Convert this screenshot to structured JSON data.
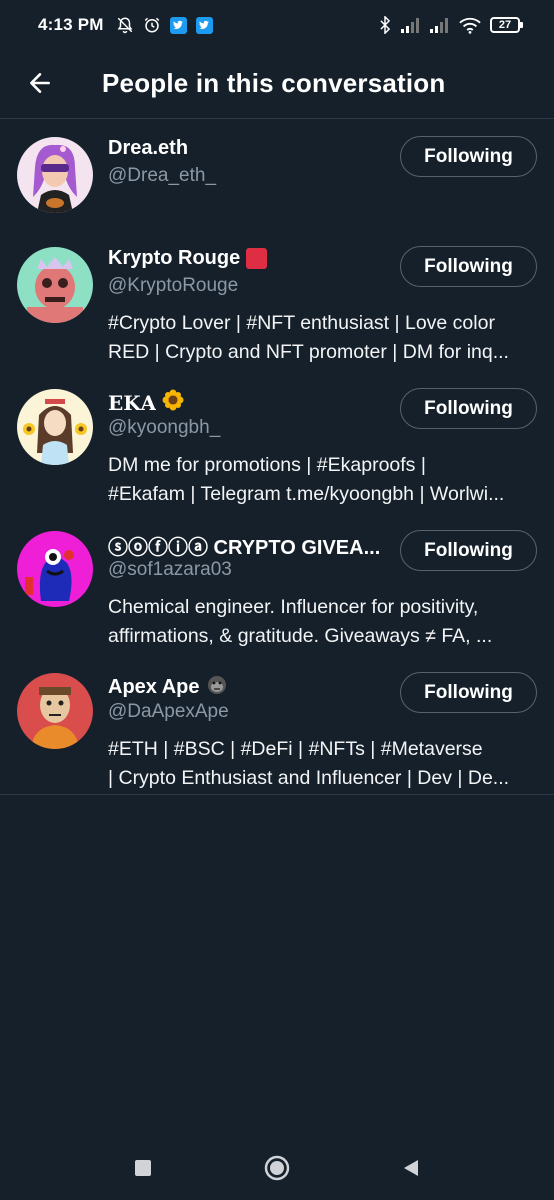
{
  "status_bar": {
    "time": "4:13 PM",
    "left_icons": [
      "notifications-off-icon",
      "alarm-icon",
      "twitter-icon",
      "twitter-icon"
    ],
    "right_icons": [
      "bluetooth-icon",
      "signal-icon",
      "signal-icon",
      "wifi-icon",
      "battery-icon"
    ],
    "battery_level": "27"
  },
  "header": {
    "back_icon": "arrow-left-icon",
    "title": "People in this conversation"
  },
  "people": [
    {
      "name": "Drea.eth",
      "badge": "",
      "handle": "@Drea_eth_",
      "bio": [],
      "button": "Following"
    },
    {
      "name": "Krypto Rouge",
      "badge": "red-square-emoji",
      "handle": "@KryptoRouge",
      "bio": [
        "#Crypto Lover | #NFT enthusiast | Love color",
        "RED | Crypto and NFT promoter | DM for inq..."
      ],
      "button": "Following"
    },
    {
      "name": "𝐄𝐊𝐀",
      "badge": "sunflower-emoji",
      "handle": "@kyoongbh_",
      "bio": [
        "DM me for promotions | #Ekaproofs |",
        "#Ekafam | Telegram t.me/kyoongbh | Worlwi..."
      ],
      "button": "Following"
    },
    {
      "name": "ⓢⓞⓕⓘⓐ CRYPTO GIVEA...",
      "badge": "",
      "handle": "@sof1azara03",
      "bio": [
        "Chemical engineer. Influencer for positivity,",
        "affirmations, & gratitude. Giveaways ≠ FA, ..."
      ],
      "button": "Following"
    },
    {
      "name": "Apex Ape",
      "badge": "gorilla-emoji",
      "handle": "@DaApexApe",
      "bio": [
        "#ETH | #BSC | #DeFi | #NFTs | #Metaverse",
        "| Crypto Enthusiast and Influencer | Dev | De..."
      ],
      "button": "Following"
    }
  ],
  "nav_bar": {
    "icons": [
      "recents-square-icon",
      "home-circle-icon",
      "back-triangle-icon"
    ]
  },
  "colors": {
    "background": "#15202b",
    "secondary_text": "#8b98a5",
    "button_border": "#56626d",
    "divider": "#2b3945"
  }
}
